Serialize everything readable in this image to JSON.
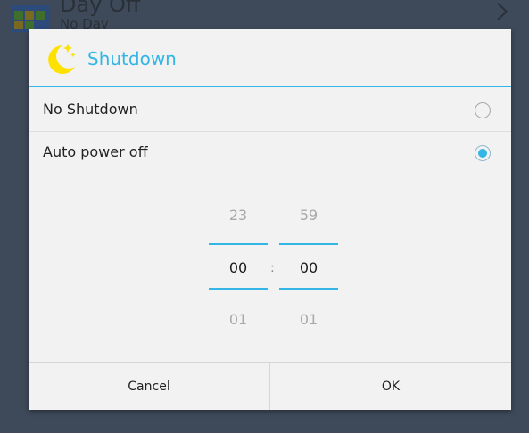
{
  "background_row": {
    "title": "Day Off",
    "subtitle": "No Day"
  },
  "dialog": {
    "title": "Shutdown",
    "options": [
      {
        "label": "No Shutdown",
        "selected": false
      },
      {
        "label": "Auto power off",
        "selected": true
      }
    ],
    "time_picker": {
      "hours": {
        "previous": "23",
        "current": "00",
        "next": "01"
      },
      "minutes": {
        "previous": "59",
        "current": "00",
        "next": "01"
      },
      "separator": ":"
    },
    "buttons": {
      "cancel": "Cancel",
      "ok": "OK"
    }
  },
  "colors": {
    "accent": "#33b5e5",
    "dialog_bg": "#f2f2f2",
    "overlay": "#3e4a5a"
  }
}
